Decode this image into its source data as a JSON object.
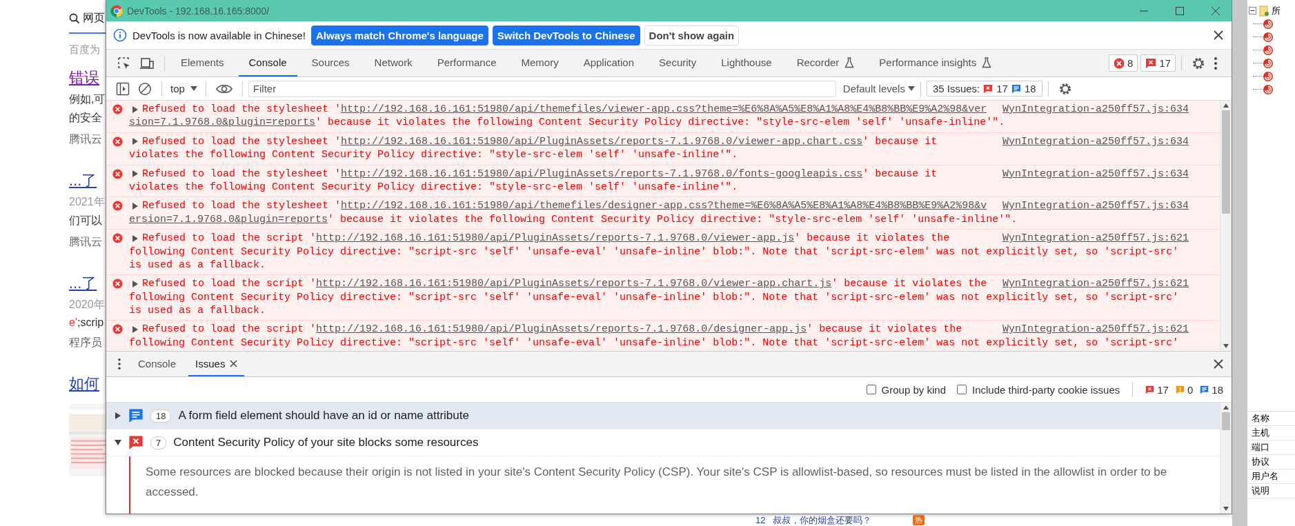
{
  "left_page": [
    {
      "kind": "search-tab",
      "text": "网页"
    },
    {
      "kind": "note",
      "text": "百度为"
    },
    {
      "kind": "title",
      "visited": true,
      "text": "错误"
    },
    {
      "kind": "text",
      "text": "例如,可"
    },
    {
      "kind": "text",
      "text": "的安全"
    },
    {
      "kind": "source",
      "text": "腾讯云"
    },
    {
      "kind": "title",
      "visited": false,
      "text": "...了"
    },
    {
      "kind": "date",
      "text": "2021年"
    },
    {
      "kind": "text",
      "text": "们可以"
    },
    {
      "kind": "source",
      "text": "腾讯云"
    },
    {
      "kind": "title",
      "visited": false,
      "text": "...了"
    },
    {
      "kind": "date",
      "text": "2020年"
    },
    {
      "kind": "code",
      "highlight": "e'",
      "text": ";scrip"
    },
    {
      "kind": "source",
      "text": "程序员"
    },
    {
      "kind": "title",
      "visited": false,
      "text": "如何"
    },
    {
      "kind": "thumbnail"
    }
  ],
  "window": {
    "title": "DevTools - 192.168.16.165:8000/"
  },
  "infobar": {
    "message": "DevTools is now available in Chinese!",
    "buttons": [
      {
        "label": "Always match Chrome's language",
        "primary": true
      },
      {
        "label": "Switch DevTools to Chinese",
        "primary": true
      },
      {
        "label": "Don't show again",
        "primary": false
      }
    ]
  },
  "tabs": [
    {
      "label": "Elements",
      "selected": false,
      "experimental": false
    },
    {
      "label": "Console",
      "selected": true,
      "experimental": false
    },
    {
      "label": "Sources",
      "selected": false,
      "experimental": false
    },
    {
      "label": "Network",
      "selected": false,
      "experimental": false
    },
    {
      "label": "Performance",
      "selected": false,
      "experimental": false
    },
    {
      "label": "Memory",
      "selected": false,
      "experimental": false
    },
    {
      "label": "Application",
      "selected": false,
      "experimental": false
    },
    {
      "label": "Security",
      "selected": false,
      "experimental": false
    },
    {
      "label": "Lighthouse",
      "selected": false,
      "experimental": false
    },
    {
      "label": "Recorder",
      "selected": false,
      "experimental": true
    },
    {
      "label": "Performance insights",
      "selected": false,
      "experimental": true
    }
  ],
  "counters": {
    "errors": "8",
    "issues": "17"
  },
  "console_toolbar": {
    "context": "top",
    "filter_placeholder": "Filter",
    "levels": "Default levels",
    "issues_label": "35 Issues:",
    "issue_errors": "17",
    "issue_info": "18"
  },
  "messages": [
    {
      "source": "WynIntegration-a250ff57.js:634",
      "lines": [
        {
          "before": "Refused to load the stylesheet '",
          "link": "http://192.168.16.161:51980/api/themefiles/viewer-app.css?theme=%E6%8A%A5%E8%A1%A8%E4%B8%BB%E9%A2%98&ver"
        },
        {
          "link": "sion=7.1.9768.0&plugin=reports",
          "after": "' because it violates the following Content Security Policy directive: \"style-src-elem 'self' 'unsafe-inline'\"."
        }
      ]
    },
    {
      "source": "WynIntegration-a250ff57.js:634",
      "lines": [
        {
          "before": "Refused to load the stylesheet '",
          "link": "http://192.168.16.161:51980/api/PluginAssets/reports-7.1.9768.0/viewer-app.chart.css",
          "after": "' because it"
        },
        {
          "before": "violates the following Content Security Policy directive: \"style-src-elem 'self' 'unsafe-inline'\"."
        }
      ]
    },
    {
      "source": "WynIntegration-a250ff57.js:634",
      "lines": [
        {
          "before": "Refused to load the stylesheet '",
          "link": "http://192.168.16.161:51980/api/PluginAssets/reports-7.1.9768.0/fonts-googleapis.css",
          "after": "' because it"
        },
        {
          "before": "violates the following Content Security Policy directive: \"style-src-elem 'self' 'unsafe-inline'\"."
        }
      ]
    },
    {
      "source": "WynIntegration-a250ff57.js:634",
      "lines": [
        {
          "before": "Refused to load the stylesheet '",
          "link": "http://192.168.16.161:51980/api/themefiles/designer-app.css?theme=%E6%8A%A5%E8%A1%A8%E4%B8%BB%E9%A2%98&v"
        },
        {
          "link": "ersion=7.1.9768.0&plugin=reports",
          "after": "' because it violates the following Content Security Policy directive: \"style-src-elem 'self' 'unsafe-inline'\"."
        }
      ]
    },
    {
      "source": "WynIntegration-a250ff57.js:621",
      "lines": [
        {
          "before": "Refused to load the script '",
          "link": "http://192.168.16.161:51980/api/PluginAssets/reports-7.1.9768.0/viewer-app.js",
          "after": "' because it violates the"
        },
        {
          "before": "following Content Security Policy directive: \"script-src 'self' 'unsafe-eval' 'unsafe-inline' blob:\". Note that 'script-src-elem' was not explicitly set, so 'script-src'"
        },
        {
          "before": "is used as a fallback."
        }
      ]
    },
    {
      "source": "WynIntegration-a250ff57.js:621",
      "lines": [
        {
          "before": "Refused to load the script '",
          "link": "http://192.168.16.161:51980/api/PluginAssets/reports-7.1.9768.0/viewer-app.chart.js",
          "after": "' because it violates the"
        },
        {
          "before": "following Content Security Policy directive: \"script-src 'self' 'unsafe-eval' 'unsafe-inline' blob:\". Note that 'script-src-elem' was not explicitly set, so 'script-src'"
        },
        {
          "before": "is used as a fallback."
        }
      ]
    },
    {
      "source": "WynIntegration-a250ff57.js:621",
      "lines": [
        {
          "before": "Refused to load the script '",
          "link": "http://192.168.16.161:51980/api/PluginAssets/reports-7.1.9768.0/designer-app.js",
          "after": "' because it violates the"
        },
        {
          "before": "following Content Security Policy directive: \"script-src 'self' 'unsafe-eval' 'unsafe-inline' blob:\". Note that 'script-src-elem' was not explicitly set, so 'script-src'"
        }
      ]
    }
  ],
  "drawer": {
    "tabs": [
      {
        "label": "Console",
        "selected": false,
        "closable": false
      },
      {
        "label": "Issues",
        "selected": true,
        "closable": true
      }
    ],
    "checkboxes": [
      {
        "label": "Group by kind",
        "checked": false
      },
      {
        "label": "Include third-party cookie issues",
        "checked": false
      }
    ],
    "counts": {
      "errors": "17",
      "warnings": "0",
      "info": "18"
    },
    "issues": [
      {
        "kind": "info",
        "count": "18",
        "title": "A form field element should have an id or name attribute",
        "expanded": false,
        "selected": true
      },
      {
        "kind": "error",
        "count": "7",
        "title": "Content Security Policy of your site blocks some resources",
        "expanded": true,
        "selected": false,
        "description": "Some resources are blocked because their origin is not listed in your site's Content Security Policy (CSP). Your site's CSP is allowlist-based, so resources must be listed in the allowlist in order to be accessed."
      }
    ]
  },
  "bottom_page": {
    "text": "12   叔叔，你的烟盒还要吗？",
    "badge": "热"
  },
  "right_panel": {
    "tree_root": {
      "label": "所",
      "expanded": true
    },
    "fields": [
      "名称",
      "主机",
      "端口",
      "协议",
      "用户名",
      "说明"
    ]
  }
}
